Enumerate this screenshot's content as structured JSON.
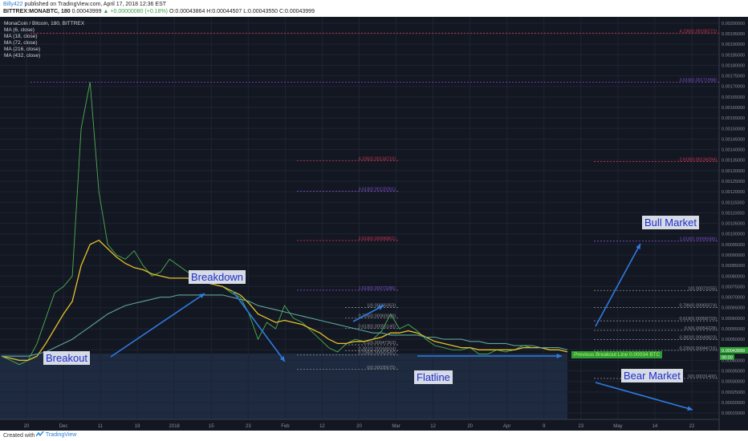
{
  "header": {
    "author": "Billy422",
    "published": "published on TradingView.com, April 17, 2018 12:36 EST",
    "symbol": "BITTREX:MONABTC, 180",
    "last": "0.00043999",
    "change": "▲ +0.00000080 (+0.18%)",
    "ohlc": "O:0.00043864 H:0.00044507 L:0.00043550 C:0.00043999"
  },
  "legend": {
    "title": "MonaCoin / Bitcoin, 180, BITTREX",
    "ma": [
      "MA (6, close)",
      "MA (18, close)",
      "MA (72, close)",
      "MA (216, close)",
      "MA (432, close)"
    ]
  },
  "callouts": {
    "breakout": "Breakout",
    "breakdown": "Breakdown",
    "flatline": "Flatline",
    "bull": "Bull Market",
    "bear": "Bear Market",
    "green_note": "Previous Breakout Line 0.00034 BTC"
  },
  "footer": {
    "created": "Created with",
    "brand": "TradingView"
  },
  "colors": {
    "background": "#131722",
    "price": "#4caf50",
    "ma_yellow": "#e6c229",
    "ma_red": "#d63b3b",
    "ma_teal": "#5fa49a",
    "arrow": "#2f7be0",
    "fib_purple": "#7b4fc2",
    "fib_red": "#c8334f"
  },
  "chart_data": {
    "type": "line",
    "title": "MonaCoin / Bitcoin, 180, BITTREX",
    "x_ticks": [
      "20",
      "Dec",
      "11",
      "19",
      "2018",
      "15",
      "23",
      "Feb",
      "12",
      "20",
      "Mar",
      "12",
      "20",
      "Apr",
      "9",
      "23",
      "May",
      "14",
      "22"
    ],
    "y_ticks": [
      "0.00200000",
      "0.00195000",
      "0.00190000",
      "0.00185000",
      "0.00180000",
      "0.00175000",
      "0.00170000",
      "0.00165000",
      "0.00160000",
      "0.00155000",
      "0.00150000",
      "0.00145000",
      "0.00140000",
      "0.00135000",
      "0.00130000",
      "0.00125000",
      "0.00120000",
      "0.00115000",
      "0.00110000",
      "0.00105000",
      "0.00100000",
      "0.00095000",
      "0.00090000",
      "0.00085000",
      "0.00080000",
      "0.00075000",
      "0.00070000",
      "0.00065000",
      "0.00060000",
      "0.00055000",
      "0.00050000",
      "0.00045000",
      "0.00040000",
      "0.00035000",
      "0.00030000",
      "0.00025000",
      "0.00020000",
      "0.00015000"
    ],
    "ylim": [
      0.00012,
      0.00203
    ],
    "series": [
      {
        "values": [
          0.00042,
          0.0004,
          0.00038,
          0.0004,
          0.00048,
          0.0006,
          0.00072,
          0.00075,
          0.0008,
          0.0015,
          0.00172,
          0.0012,
          0.00095,
          0.0009,
          0.00088,
          0.00092,
          0.00085,
          0.0008,
          0.00082,
          0.00088,
          0.00085,
          0.00082,
          0.0008,
          0.00078,
          0.00076,
          0.00075,
          0.00072,
          0.0007,
          0.00062,
          0.0005,
          0.00058,
          0.00055,
          0.00066,
          0.0006,
          0.00058,
          0.00054,
          0.0005,
          0.00046,
          0.00044,
          0.00048,
          0.0005,
          0.00049,
          0.0005,
          0.00054,
          0.00062,
          0.00055,
          0.00057,
          0.00054,
          0.0005,
          0.00047,
          0.00046,
          0.00045,
          0.00045,
          0.00046,
          0.00043,
          0.00043,
          0.00045,
          0.00044,
          0.00045,
          0.00047,
          0.00046,
          0.00046,
          0.00045,
          0.00045,
          0.00044
        ]
      },
      {
        "values": [
          0.00042,
          0.00041,
          0.0004,
          0.0004,
          0.00042,
          0.00048,
          0.00055,
          0.00062,
          0.00068,
          0.00085,
          0.00095,
          0.00097,
          0.00093,
          0.00089,
          0.00086,
          0.00084,
          0.00083,
          0.00081,
          0.0008,
          0.00079,
          0.00079,
          0.00079,
          0.00078,
          0.00077,
          0.00076,
          0.00075,
          0.00073,
          0.00071,
          0.00067,
          0.00062,
          0.0006,
          0.00058,
          0.00059,
          0.00058,
          0.00057,
          0.00055,
          0.00053,
          0.0005,
          0.00048,
          0.00048,
          0.00049,
          0.00049,
          0.0005,
          0.00051,
          0.00053,
          0.00053,
          0.00054,
          0.00053,
          0.00051,
          0.00049,
          0.00048,
          0.00047,
          0.00046,
          0.00046,
          0.00045,
          0.00045,
          0.00045,
          0.00045,
          0.00045,
          0.00046,
          0.00046,
          0.00046,
          0.00045,
          0.00045,
          0.00044
        ]
      },
      {
        "values": [
          0.00042,
          0.00042,
          0.00042,
          0.00042,
          0.00043,
          0.00044,
          0.00046,
          0.00048,
          0.0005,
          0.00053,
          0.00056,
          0.00059,
          0.00062,
          0.00064,
          0.00066,
          0.00067,
          0.00068,
          0.00069,
          0.0007,
          0.0007,
          0.00071,
          0.00071,
          0.00071,
          0.00071,
          0.00071,
          0.00071,
          0.0007,
          0.00069,
          0.00068,
          0.00066,
          0.00065,
          0.00064,
          0.00063,
          0.00062,
          0.00061,
          0.0006,
          0.00059,
          0.00058,
          0.00057,
          0.00056,
          0.00055,
          0.00054,
          0.00053,
          0.00053,
          0.00052,
          0.00052,
          0.00052,
          0.00052,
          0.00051,
          0.00051,
          0.0005,
          0.0005,
          0.0005,
          0.00049,
          0.00049,
          0.00048,
          0.00048,
          0.00048,
          0.00047,
          0.00047,
          0.00047,
          0.00046,
          0.00046,
          0.00046,
          0.00045
        ]
      }
    ],
    "fib_levels": [
      {
        "label": "4.236(0.00195272)",
        "value": 0.00195272
      },
      {
        "label": "3.618(0.00171998)",
        "value": 0.00171998
      },
      {
        "label": "4.236(0.00134710)",
        "value": 0.0013471
      },
      {
        "label": "2.618(0.00134294)",
        "value": 0.00134294
      },
      {
        "label": "3.618(0.00120261)",
        "value": 0.00120261
      },
      {
        "label": "2.618(0.00096861)",
        "value": 0.00096861
      },
      {
        "label": "1.618(0.00096586)",
        "value": 0.00096586
      },
      {
        "label": "1.618(0.00073286)",
        "value": 0.00073286
      },
      {
        "label": "1(0.00073155)",
        "value": 0.00073155
      },
      {
        "label": "1(0.00065053)",
        "value": 0.00065053
      },
      {
        "label": "0.786(0.00065074)",
        "value": 0.00065074
      },
      {
        "label": "0.786(0.00060049)",
        "value": 0.00060049
      },
      {
        "label": "0.618(0.00058733)",
        "value": 0.00058733
      },
      {
        "label": "0.618(0.00055140)",
        "value": 0.0005514
      },
      {
        "label": "0.5(0.00054228)",
        "value": 0.00054228
      },
      {
        "label": "0.5(0.00047363)",
        "value": 0.00047363
      },
      {
        "label": "0.382(0.00049823)",
        "value": 0.00049823
      },
      {
        "label": "0.382(0.00044604)",
        "value": 0.00044604
      },
      {
        "label": "0.236(0.00044716)",
        "value": 0.00044716
      },
      {
        "label": "0.236(0.00042541)",
        "value": 0.00042541
      },
      {
        "label": "0(0.00035675)",
        "value": 0.00035675
      },
      {
        "label": "0(0.00031400)",
        "value": 0.000314
      }
    ],
    "price_badges": [
      "0.00043999",
      "00:00"
    ]
  }
}
